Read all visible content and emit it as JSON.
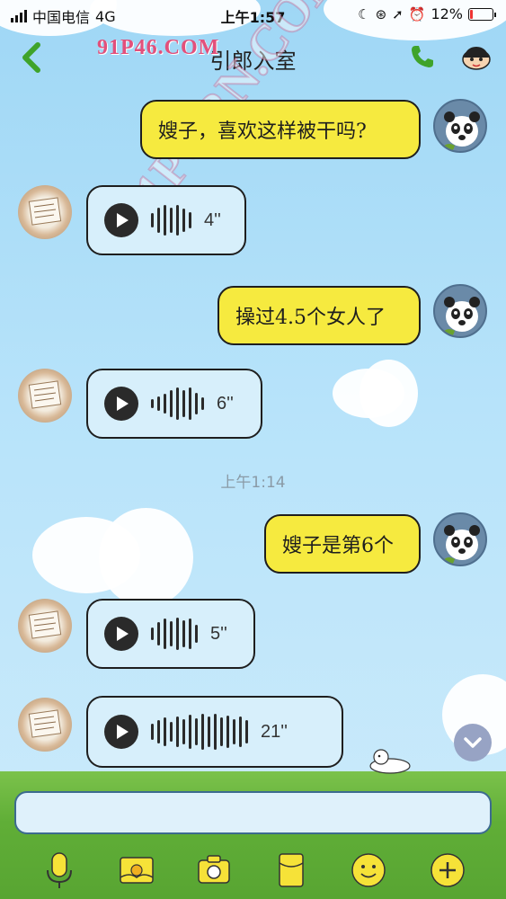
{
  "status_bar": {
    "carrier": "中国电信",
    "network": "4G",
    "time": "上午1:57",
    "battery": "12%",
    "battery_level": 0.12
  },
  "header": {
    "title": "引郎入室",
    "watermark": "91P46.COM"
  },
  "messages": [
    {
      "side": "right",
      "type": "text",
      "text": "嫂子，喜欢这样被干吗?"
    },
    {
      "side": "left",
      "type": "voice",
      "duration": "4''"
    },
    {
      "side": "right",
      "type": "text",
      "text": "操过4.5个女人了"
    },
    {
      "side": "left",
      "type": "voice",
      "duration": "6''"
    },
    {
      "side": "right",
      "type": "text",
      "text": "嫂子是第6个"
    },
    {
      "side": "left",
      "type": "voice",
      "duration": "5''"
    },
    {
      "side": "left",
      "type": "voice",
      "duration": "21''"
    }
  ],
  "timestamp": "上午1:14",
  "watermark_diagonal": "91PORN.COM",
  "icons": {
    "back": "chevron-left-icon",
    "call": "phone-icon",
    "profile": "character-icon",
    "voice_input": "microphone-icon",
    "album": "image-icon",
    "camera": "camera-icon",
    "red_packet": "red-packet-icon",
    "emoji": "smiley-icon",
    "more": "plus-icon",
    "scroll": "chevron-down-icon"
  },
  "colors": {
    "accent_green": "#4aa52a",
    "bubble_yellow": "#f6ea3f",
    "bubble_blue": "#d7effb"
  }
}
